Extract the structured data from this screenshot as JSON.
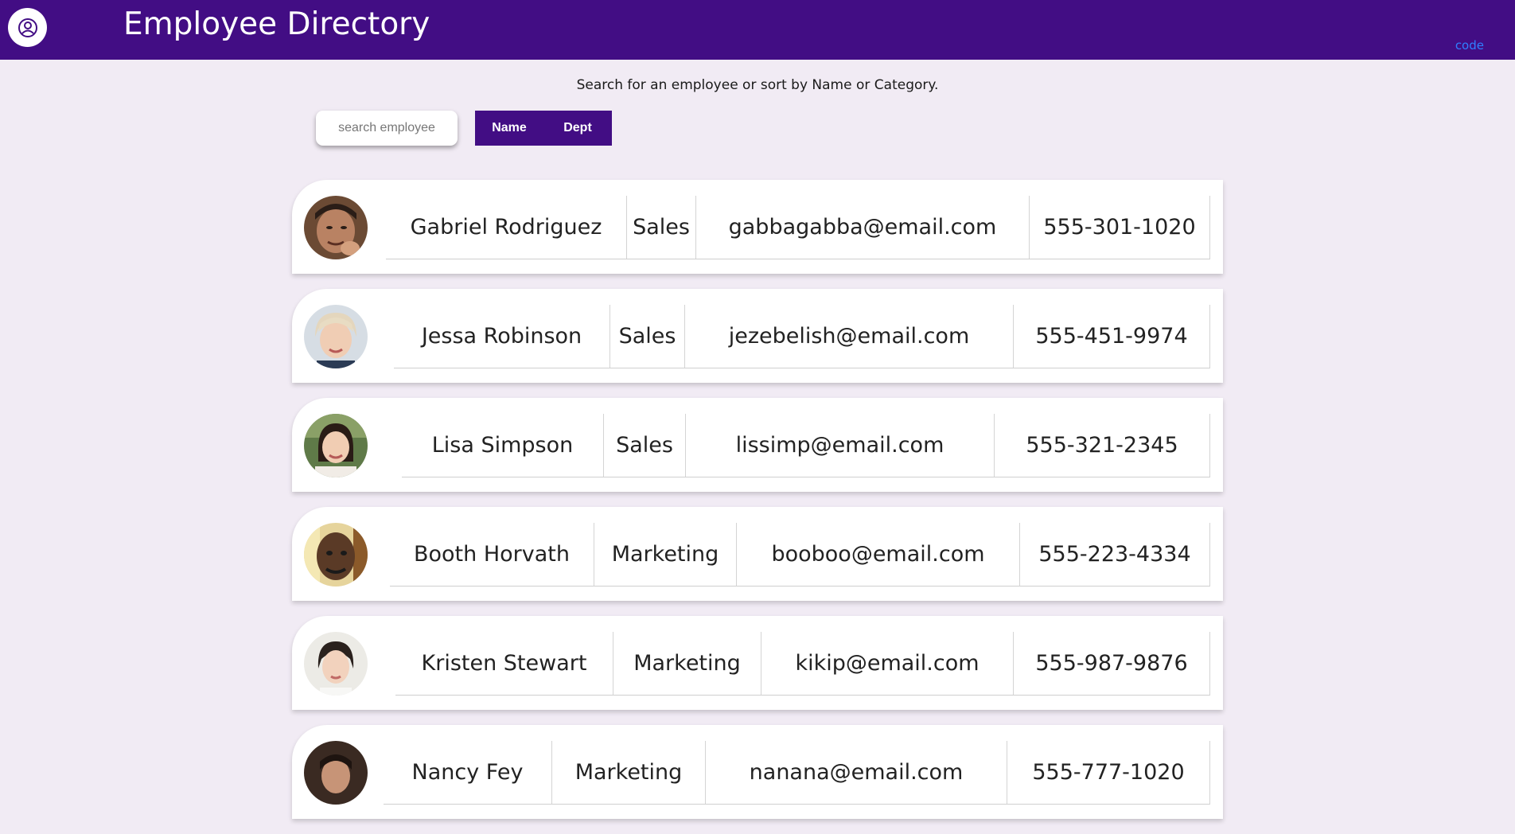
{
  "header": {
    "title": "Employee Directory",
    "code_link": "code",
    "logo_icon": "user-circle-icon"
  },
  "subtitle": "Search for an employee or sort by Name or Category.",
  "search": {
    "placeholder": "search employee",
    "value": ""
  },
  "sort": {
    "name_label": "Name",
    "dept_label": "Dept"
  },
  "colors": {
    "header_bg": "#420d84",
    "page_bg": "#f1ebf4",
    "link": "#2f7fff"
  },
  "employees": [
    {
      "name": "Gabriel Rodriguez",
      "dept": "Sales",
      "email": "gabbagabba@email.com",
      "phone": "555-301-1020"
    },
    {
      "name": "Jessa Robinson",
      "dept": "Sales",
      "email": "jezebelish@email.com",
      "phone": "555-451-9974"
    },
    {
      "name": "Lisa Simpson",
      "dept": "Sales",
      "email": "lissimp@email.com",
      "phone": "555-321-2345"
    },
    {
      "name": "Booth Horvath",
      "dept": "Marketing",
      "email": "booboo@email.com",
      "phone": "555-223-4334"
    },
    {
      "name": "Kristen Stewart",
      "dept": "Marketing",
      "email": "kikip@email.com",
      "phone": "555-987-9876"
    },
    {
      "name": "Nancy Fey",
      "dept": "Marketing",
      "email": "nanana@email.com",
      "phone": "555-777-1020"
    }
  ]
}
